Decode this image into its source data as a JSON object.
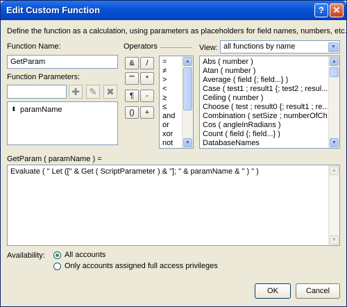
{
  "window": {
    "title": "Edit Custom Function",
    "help_label": "?",
    "close_label": "✕"
  },
  "description": "Define the function as a calculation, using parameters as placeholders for field names, numbers, etc.",
  "function_name": {
    "label": "Function Name:",
    "value": "GetParam"
  },
  "function_parameters": {
    "label": "Function Parameters:",
    "input_value": "",
    "items": [
      "paramName"
    ],
    "add_icon": "plus-icon",
    "edit_icon": "pencil-icon",
    "delete_icon": "x-icon"
  },
  "operators": {
    "label": "Operators",
    "buttons": [
      "&",
      "/",
      "\"\"",
      "*",
      "¶",
      "-",
      "()",
      "+"
    ],
    "list": [
      "=",
      "≠",
      ">",
      "<",
      "≥",
      "≤",
      "and",
      "or",
      "xor",
      "not"
    ]
  },
  "view": {
    "label": "View:",
    "selected": "all functions by name",
    "functions": [
      "Abs ( number )",
      "Atan ( number )",
      "Average ( field {; field...} )",
      "Case ( test1 ; result1 {; test2 ; resul...",
      "Ceiling ( number )",
      "Choose ( test ; result0 {; result1 ; re...",
      "Combination ( setSize ; numberOfCh...",
      "Cos ( angleInRadians )",
      "Count ( field {; field...} )",
      "DatabaseNames"
    ]
  },
  "signature": "GetParam ( paramName ) =",
  "formula": "Evaluate ( \" Let ([\" & Get ( ScriptParameter ) & \"]; \" & paramName & \" ) \" )",
  "availability": {
    "label": "Availability:",
    "options": [
      {
        "label": "All accounts",
        "selected": true
      },
      {
        "label": "Only accounts assigned full access privileges",
        "selected": false
      }
    ]
  },
  "buttons": {
    "ok": "OK",
    "cancel": "Cancel"
  },
  "colors": {
    "titlebar": "#0348c8",
    "face": "#ece9d8",
    "border": "#7f9db9",
    "radio_dot": "#21a121"
  }
}
